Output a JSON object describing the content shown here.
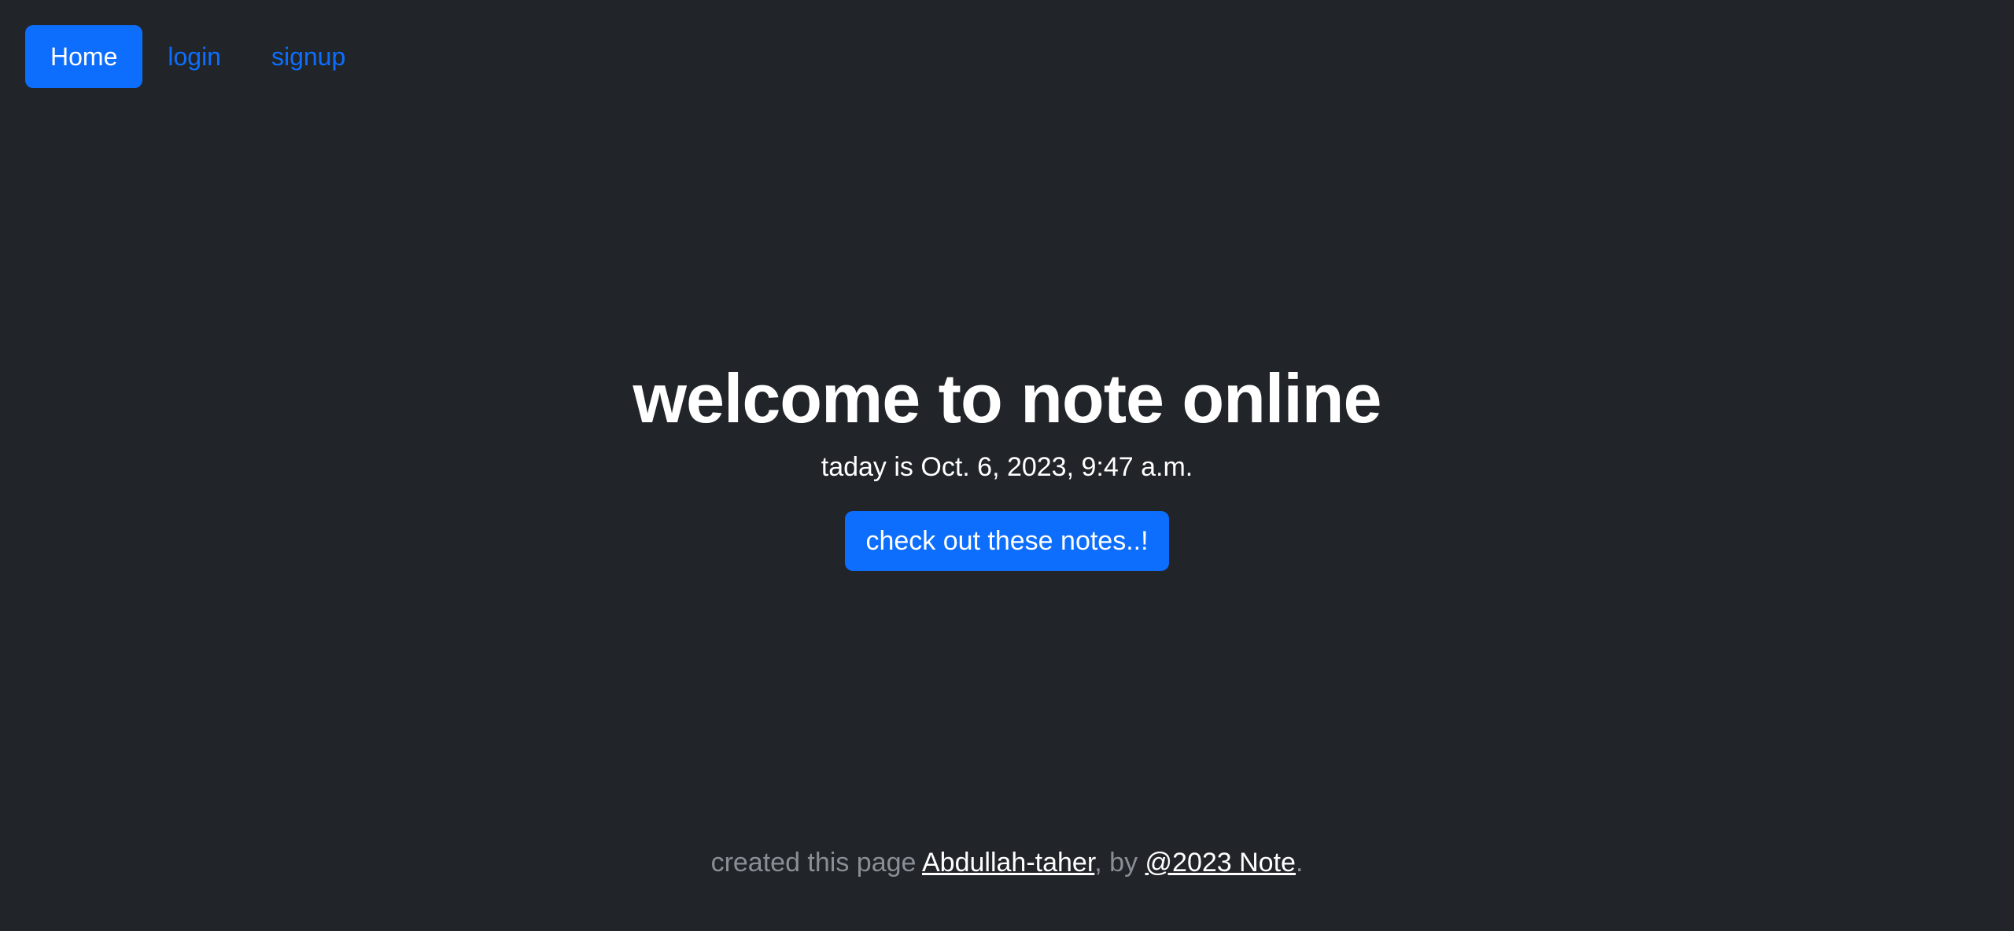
{
  "nav": {
    "items": [
      {
        "label": "Home",
        "active": true
      },
      {
        "label": "login",
        "active": false
      },
      {
        "label": "signup",
        "active": false
      }
    ]
  },
  "hero": {
    "title": "welcome to note online",
    "date_text": "taday is Oct. 6, 2023, 9:47 a.m.",
    "cta_label": "check out these notes..!"
  },
  "footer": {
    "prefix": "created this page ",
    "author_link": "Abdullah-taher",
    "middle": ", by ",
    "brand_link": "@2023 Note",
    "suffix": "."
  },
  "colors": {
    "background": "#212529",
    "accent": "#0d6efd",
    "text": "#ffffff",
    "muted": "#8a8f96"
  }
}
